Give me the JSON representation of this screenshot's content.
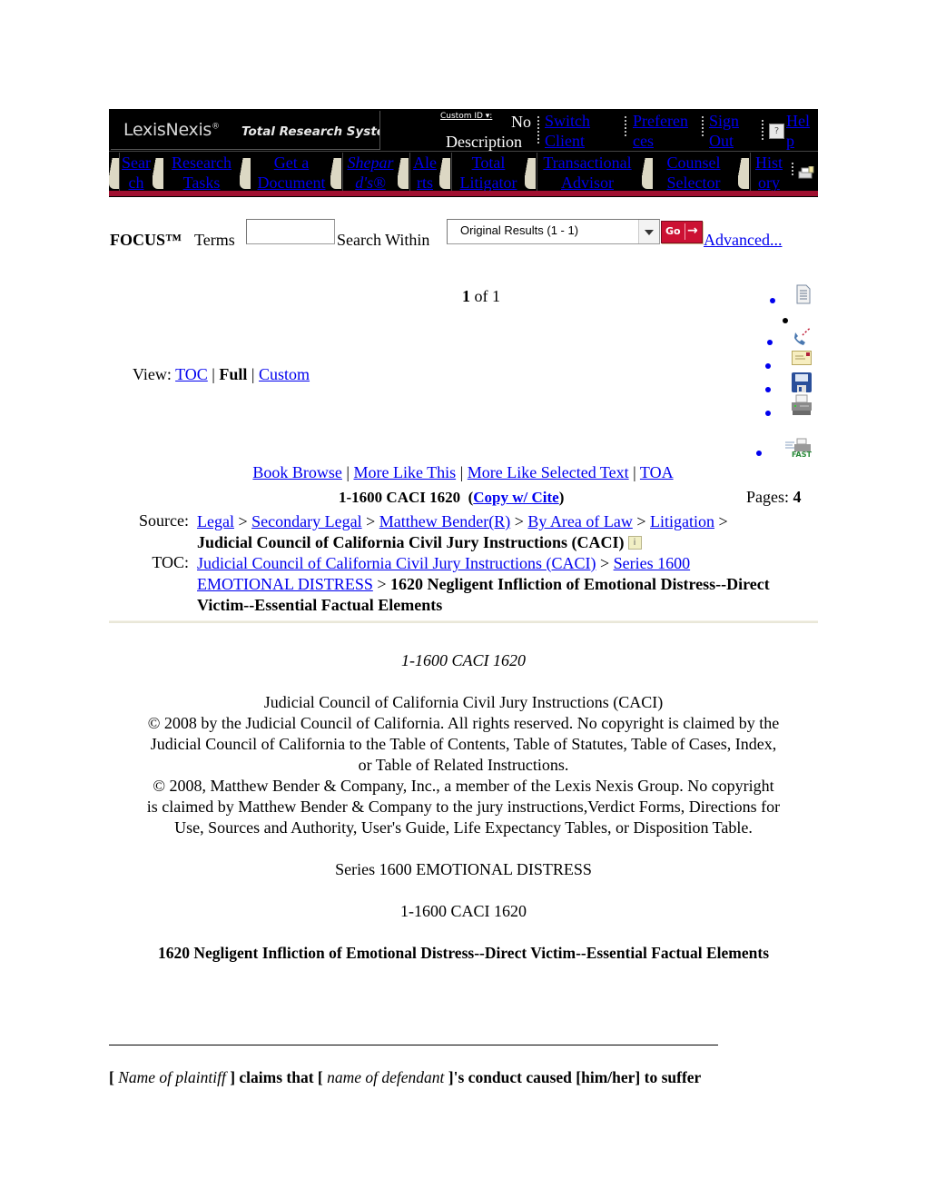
{
  "header": {
    "logo_brand": "LexisNexis",
    "logo_reg": "®",
    "logo_product": "Total Research System",
    "custom_id_label": "Custom ID ▾:",
    "custom_id_value": "No",
    "custom_id_value2": "Description",
    "top_links": [
      {
        "line1": "Switch ",
        "line2": "Client"
      },
      {
        "line1": "Preferen",
        "line2": "ces"
      },
      {
        "line1": "Sign ",
        "line2": "Out"
      },
      {
        "line1": "Hel",
        "line2": "p"
      }
    ],
    "nav_tabs": [
      {
        "line1": "Sear",
        "line2": "ch"
      },
      {
        "line1": "Research",
        "line2": "Tasks"
      },
      {
        "line1": "Get a",
        "line2": "Document"
      },
      {
        "line1": "Shepar",
        "line2": "d's®"
      },
      {
        "line1": "Ale",
        "line2": "rts"
      },
      {
        "line1": "Total",
        "line2": "Litigator"
      },
      {
        "line1": "Transactional",
        "line2": "Advisor"
      },
      {
        "line1": "Counsel",
        "line2": "Selector"
      },
      {
        "line1": "Hist",
        "line2": "ory"
      }
    ],
    "accent_color": "#a01030"
  },
  "focus": {
    "label": "FOCUS™",
    "terms_word": "Terms",
    "terms_value": "",
    "search_within_label": "Search Within",
    "search_within_selected": "Original Results (1 - 1)",
    "go_label": "Go",
    "advanced_label": "Advanced..."
  },
  "paging": {
    "current": "1",
    "of_label": "of 1"
  },
  "view": {
    "label": "View:",
    "toc": "TOC",
    "sep": "|",
    "full": "Full",
    "custom": "Custom"
  },
  "tools": [
    "document-icon",
    "fax-icon",
    "email-icon",
    "save-icon",
    "print-icon",
    "fast-print-icon"
  ],
  "actions": {
    "book_browse": "Book Browse",
    "more_like_this": "More Like This",
    "more_like_selected": "More Like Selected Text",
    "toa": "TOA",
    "sep": "|"
  },
  "citation": {
    "cite": "1-1600 CACI 1620",
    "copy_open": "(",
    "copy_label": "Copy w/ Cite",
    "copy_close": ")",
    "pages_label": "Pages:",
    "pages_value": "4"
  },
  "source": {
    "label": "Source:",
    "crumbs": [
      "Legal",
      "Secondary Legal",
      "Matthew Bender(R)",
      "By Area of Law",
      "Litigation"
    ],
    "sep": ">",
    "current": "Judicial Council of California Civil Jury Instructions (CACI)"
  },
  "toc": {
    "label": "TOC:",
    "crumbs": [
      "Judicial Council of California Civil Jury Instructions (CACI)",
      "Series 1600 EMOTIONAL DISTRESS"
    ],
    "sep": ">",
    "current": "1620 Negligent Infliction of Emotional Distress--Direct Victim--Essential Factual Elements"
  },
  "document": {
    "cite_italic": "1-1600 CACI 1620",
    "copyright_lines": [
      "Judicial Council of California Civil Jury Instructions (CACI)",
      "© 2008 by the Judicial Council of California. All rights reserved. No copyright is claimed by the",
      "Judicial Council of California to the Table of Contents, Table of Statutes, Table of Cases, Index,",
      "or Table of Related Instructions.",
      "© 2008, Matthew Bender & Company, Inc., a member of the Lexis Nexis  Group. No copyright",
      "is claimed by Matthew Bender & Company to the jury instructions,Verdict Forms, Directions for",
      "Use, Sources and Authority, User's Guide, Life Expectancy Tables, or Disposition Table."
    ],
    "series_heading": "Series 1600 EMOTIONAL DISTRESS",
    "cite_plain": "1-1600 CACI 1620",
    "title": "1620 Negligent Infliction of Emotional Distress--Direct Victim--Essential Factual Elements",
    "instruction": {
      "open1": "[",
      "plaintiff": " Name of plaintiff ",
      "mid": "] claims that [",
      "defendant": " name of defendant ",
      "end": "]'s conduct caused [him/her] to suffer"
    }
  }
}
